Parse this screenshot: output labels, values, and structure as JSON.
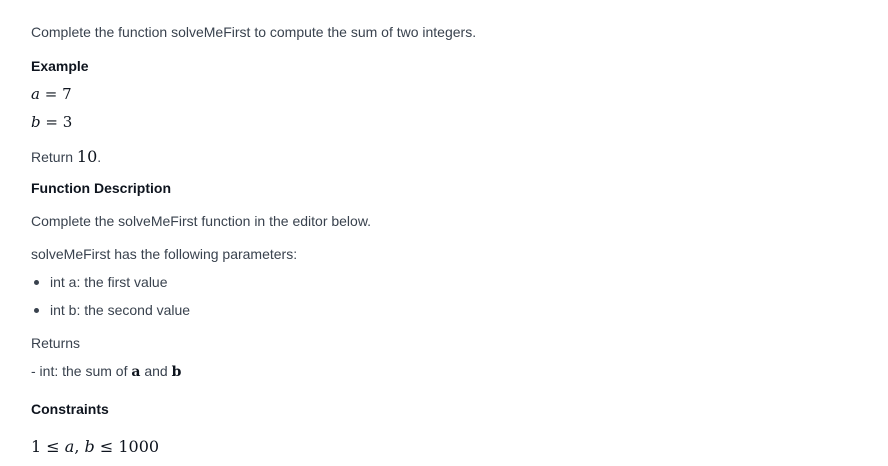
{
  "intro": "Complete the function solveMeFirst to compute the sum of two integers.",
  "example": {
    "heading": "Example",
    "a_var": "a",
    "a_eq": "= 7",
    "b_var": "b",
    "b_eq": "= 3",
    "return_label": "Return",
    "return_value": "10",
    "return_period": "."
  },
  "function_description": {
    "heading": "Function Description",
    "editor_note": "Complete the solveMeFirst function in the editor below.",
    "params_intro": "solveMeFirst has the following parameters:",
    "params": [
      "int a: the first value",
      "int b: the second value"
    ]
  },
  "returns": {
    "label": "Returns",
    "text_prefix": "- int: the sum of",
    "var_a": "a",
    "and": "and",
    "var_b": "b"
  },
  "constraints": {
    "heading": "Constraints",
    "lower": "1",
    "le1": "≤",
    "var_a": "a",
    "comma": ",",
    "var_b": "b",
    "le2": "≤",
    "upper": "1000"
  }
}
